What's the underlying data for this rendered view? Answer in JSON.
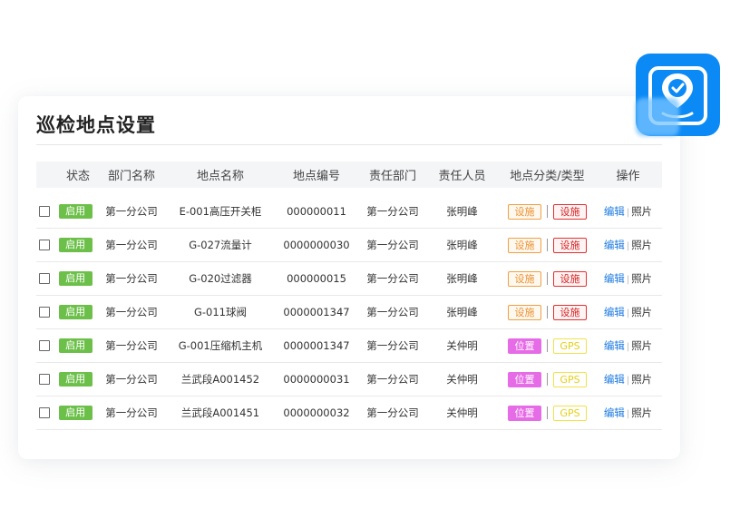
{
  "page": {
    "title": "巡检地点设置"
  },
  "table": {
    "headers": [
      "状态",
      "部门名称",
      "地点名称",
      "地点编号",
      "责任部门",
      "责任人员",
      "地点分类/类型",
      "操作"
    ],
    "rows": [
      {
        "status": "启用",
        "dept": "第一分公司",
        "location": "E-001高压开关柜",
        "code": "000000011",
        "resp_dept": "第一分公司",
        "person": "张明峰",
        "category": "设施",
        "type": "设施",
        "category_color": "orange",
        "type_color": "red",
        "edit": "编辑",
        "photo": "照片"
      },
      {
        "status": "启用",
        "dept": "第一分公司",
        "location": "G-027流量计",
        "code": "0000000030",
        "resp_dept": "第一分公司",
        "person": "张明峰",
        "category": "设施",
        "type": "设施",
        "category_color": "orange",
        "type_color": "red",
        "edit": "编辑",
        "photo": "照片"
      },
      {
        "status": "启用",
        "dept": "第一分公司",
        "location": "G-020过滤器",
        "code": "000000015",
        "resp_dept": "第一分公司",
        "person": "张明峰",
        "category": "设施",
        "type": "设施",
        "category_color": "orange",
        "type_color": "red",
        "edit": "编辑",
        "photo": "照片"
      },
      {
        "status": "启用",
        "dept": "第一分公司",
        "location": "G-011球阀",
        "code": "0000001347",
        "resp_dept": "第一分公司",
        "person": "张明峰",
        "category": "设施",
        "type": "设施",
        "category_color": "orange",
        "type_color": "red",
        "edit": "编辑",
        "photo": "照片"
      },
      {
        "status": "启用",
        "dept": "第一分公司",
        "location": "G-001压缩机主机",
        "code": "0000001347",
        "resp_dept": "第一分公司",
        "person": "关仲明",
        "category": "位置",
        "type": "GPS",
        "category_color": "purple",
        "type_color": "yellow",
        "edit": "编辑",
        "photo": "照片"
      },
      {
        "status": "启用",
        "dept": "第一分公司",
        "location": "兰武段A001452",
        "code": "0000000031",
        "resp_dept": "第一分公司",
        "person": "关仲明",
        "category": "位置",
        "type": "GPS",
        "category_color": "purple",
        "type_color": "yellow",
        "edit": "编辑",
        "photo": "照片"
      },
      {
        "status": "启用",
        "dept": "第一分公司",
        "location": "兰武段A001451",
        "code": "0000000032",
        "resp_dept": "第一分公司",
        "person": "关仲明",
        "category": "位置",
        "type": "GPS",
        "category_color": "purple",
        "type_color": "yellow",
        "edit": "编辑",
        "photo": "照片"
      }
    ]
  },
  "colors": {
    "accent": "#0b8af5",
    "status_green": "#6cc04a",
    "link_blue": "#1c7ae0"
  },
  "icons": {
    "app_badge": "location-check-icon"
  }
}
